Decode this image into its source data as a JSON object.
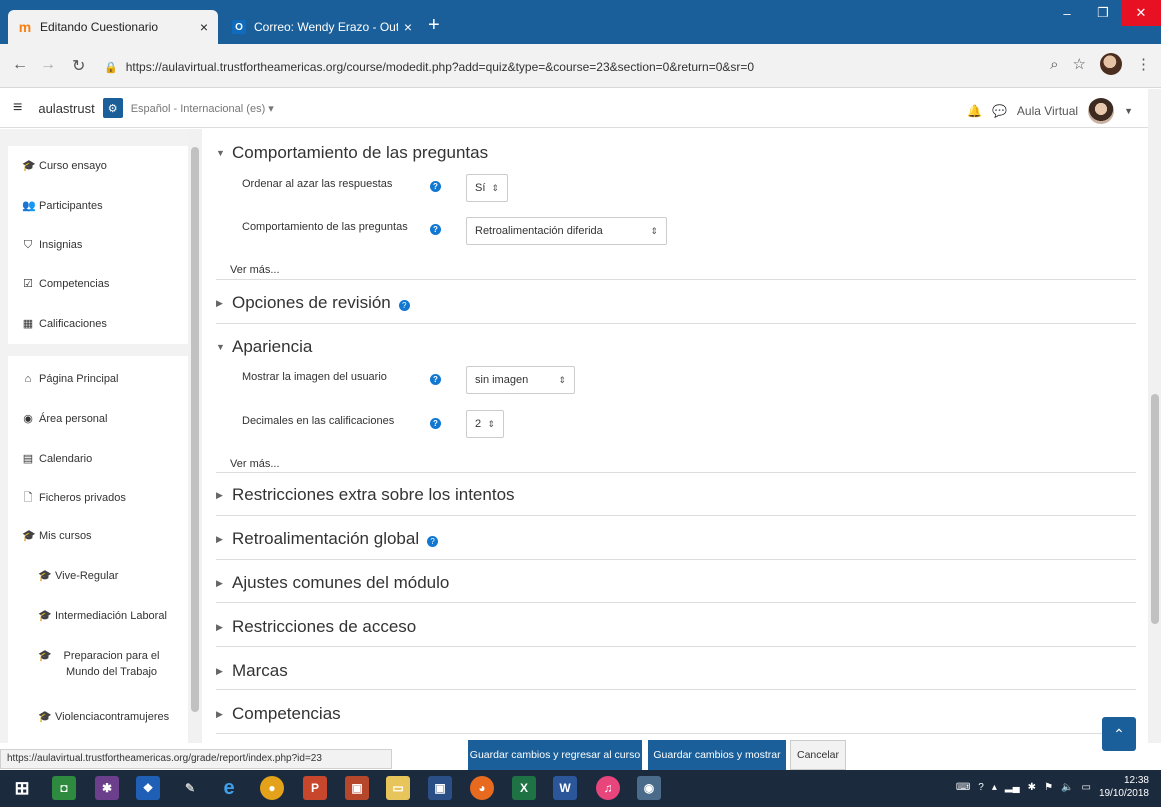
{
  "browser": {
    "tabs": [
      {
        "title": "Editando Cuestionario",
        "favicon": "moodle-icon"
      },
      {
        "title": "Correo: Wendy Erazo - Outlook",
        "favicon": "outlook-icon"
      }
    ],
    "close_glyph": "×",
    "newtab_glyph": "+",
    "url": "https://aulavirtual.trustfortheamericas.org/course/modedit.php?add=quiz&type=&course=23&section=0&return=0&sr=0"
  },
  "navbar": {
    "site_name": "aulastrust",
    "language": "Español - Internacional (es) ▾",
    "user_name": "Aula Virtual"
  },
  "drawer": {
    "course_items": [
      {
        "label": "Curso ensayo",
        "icon": "graduation-cap-icon"
      },
      {
        "label": "Participantes",
        "icon": "users-icon"
      },
      {
        "label": "Insignias",
        "icon": "shield-icon"
      },
      {
        "label": "Competencias",
        "icon": "checkbox-icon"
      },
      {
        "label": "Calificaciones",
        "icon": "table-icon"
      }
    ],
    "site_items": [
      {
        "label": "Página Principal",
        "icon": "home-icon"
      },
      {
        "label": "Área personal",
        "icon": "dashboard-icon"
      },
      {
        "label": "Calendario",
        "icon": "calendar-icon"
      },
      {
        "label": "Ficheros privados",
        "icon": "file-icon"
      },
      {
        "label": "Mis cursos",
        "icon": "graduation-cap-icon"
      }
    ],
    "course_list": [
      {
        "label": "Vive-Regular"
      },
      {
        "label": "Intermediación Laboral"
      },
      {
        "label": "Preparacion para el Mundo del Trabajo"
      },
      {
        "label": "Violenciacontramujeres"
      }
    ]
  },
  "form": {
    "section_question_behaviour": {
      "title": "Comportamiento de las preguntas",
      "field1_label": "Ordenar al azar las respuestas",
      "field1_value": "Sí",
      "field2_label": "Comportamiento de las preguntas",
      "field2_value": "Retroalimentación diferida",
      "show_more": "Ver más..."
    },
    "section_review": {
      "title": "Opciones de revisión"
    },
    "section_appearance": {
      "title": "Apariencia",
      "field1_label": "Mostrar la imagen del usuario",
      "field1_value": "sin imagen",
      "field2_label": "Decimales en las calificaciones",
      "field2_value": "2",
      "show_more": "Ver más..."
    },
    "collapsed_sections": [
      {
        "title": "Restricciones extra sobre los intentos",
        "help": false
      },
      {
        "title": "Retroalimentación global",
        "help": true
      },
      {
        "title": "Ajustes comunes del módulo",
        "help": false
      },
      {
        "title": "Restricciones de acceso",
        "help": false
      },
      {
        "title": "Marcas",
        "help": false
      },
      {
        "title": "Competencias",
        "help": false
      }
    ]
  },
  "actions": {
    "save_return": "Guardar cambios y regresar al curso",
    "save_display": "Guardar cambios y mostrar",
    "cancel": "Cancelar"
  },
  "status_url": "https://aulavirtual.trustfortheamericas.org/grade/report/index.php?id=23",
  "taskbar": {
    "time": "12:38",
    "date": "19/10/2018"
  },
  "colors": {
    "brand": "#1a5f99",
    "help": "#1177d1",
    "taskbar": "#1b2a3d"
  }
}
